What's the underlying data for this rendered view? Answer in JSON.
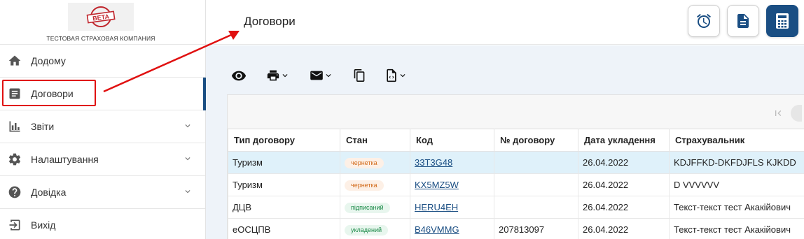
{
  "company": {
    "logo_badge": "BETA",
    "name": "ТЕСТОВАЯ СТРАХОВАЯ КОМПАНИЯ"
  },
  "sidebar": {
    "items": [
      {
        "label": "Додому",
        "icon": "home-icon"
      },
      {
        "label": "Договори",
        "icon": "document-icon",
        "active": true
      },
      {
        "label": "Звіти",
        "icon": "bar-chart-icon",
        "expandable": true
      },
      {
        "label": "Налаштування",
        "icon": "gear-icon",
        "expandable": true
      },
      {
        "label": "Довідка",
        "icon": "help-icon",
        "expandable": true
      },
      {
        "label": "Вихід",
        "icon": "logout-icon"
      }
    ]
  },
  "header": {
    "title": "Договори",
    "buttons": [
      "alarm-clock-icon",
      "file-icon",
      "calculator-icon"
    ]
  },
  "toolbar": {
    "items": [
      "view-icon",
      "print-icon",
      "email-icon",
      "copy-icon",
      "export-code-icon"
    ]
  },
  "table": {
    "columns": [
      "Тип договору",
      "Стан",
      "Код",
      "№ договору",
      "Дата укладення",
      "Страхувальник"
    ],
    "rows": [
      {
        "type": "Туризм",
        "status": "чернетка",
        "status_kind": "draft",
        "code": "33T3G48",
        "number": "",
        "date": "26.04.2022",
        "insured": "KDJFFKD-DKFDJFLS KJKDD",
        "selected": true
      },
      {
        "type": "Туризм",
        "status": "чернетка",
        "status_kind": "draft",
        "code": "KX5MZ5W",
        "number": "",
        "date": "26.04.2022",
        "insured": "D VVVVVV"
      },
      {
        "type": "ДЦВ",
        "status": "підписаний",
        "status_kind": "signed",
        "code": "HERU4EH",
        "number": "",
        "date": "26.04.2022",
        "insured": "Текст-текст тест Акакійович"
      },
      {
        "type": "еОСЦПВ",
        "status": "укладений",
        "status_kind": "signed",
        "code": "B46VMMG",
        "number": "207813097",
        "date": "26.04.2022",
        "insured": "Текст-текст тест Акакійович"
      }
    ]
  },
  "colors": {
    "brand": "#1a4e83",
    "highlight": "#e01010",
    "draft": "#d26b1b",
    "signed": "#1b8a48"
  }
}
